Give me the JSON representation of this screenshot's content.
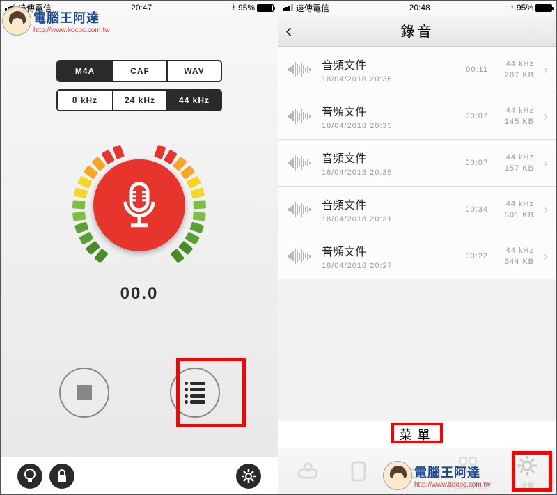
{
  "left": {
    "status": {
      "carrier": "遠傳電信",
      "time": "20:47",
      "battery": "95%"
    },
    "format_tabs": [
      "M4A",
      "CAF",
      "WAV"
    ],
    "format_active": 0,
    "rate_tabs": [
      "8 kHz",
      "24 kHz",
      "44 kHz"
    ],
    "rate_active": 2,
    "timer": "00.0",
    "watermark": {
      "title": "電腦王阿達",
      "url": "http://www.kocpc.com.tw"
    }
  },
  "right": {
    "status": {
      "carrier": "遠傳電信",
      "time": "20:48",
      "battery": "95%"
    },
    "header": "錄音",
    "recordings": [
      {
        "title": "音頻文件",
        "date": "18/04/2018 20:36",
        "duration": "00:11",
        "rate": "44 kHz",
        "size": "207 KB"
      },
      {
        "title": "音頻文件",
        "date": "18/04/2018 20:35",
        "duration": "00:07",
        "rate": "44 kHz",
        "size": "145 KB"
      },
      {
        "title": "音頻文件",
        "date": "18/04/2018 20:35",
        "duration": "00:07",
        "rate": "44 kHz",
        "size": "157 KB"
      },
      {
        "title": "音頻文件",
        "date": "18/04/2018 20:31",
        "duration": "00:34",
        "rate": "44 kHz",
        "size": "501 KB"
      },
      {
        "title": "音頻文件",
        "date": "18/04/2018 20:27",
        "duration": "00:22",
        "rate": "44 kHz",
        "size": "344 KB"
      }
    ],
    "menu_label": "菜單",
    "tabs": [
      "",
      "",
      "",
      "其他应用程序",
      "设置"
    ]
  }
}
